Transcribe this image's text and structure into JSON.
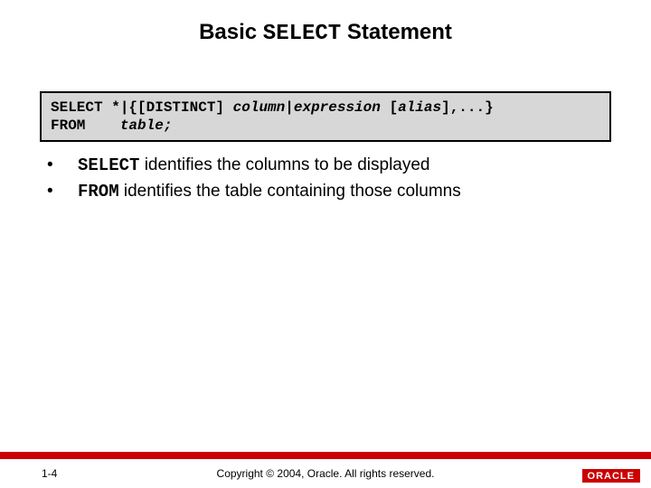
{
  "title": {
    "pre": "Basic ",
    "mono": "SELECT",
    "post": " Statement"
  },
  "syntax": {
    "line1": {
      "p1": "SELECT *|{[DISTINCT] ",
      "i1": "column",
      "p2": "|",
      "i2": "expression",
      "p3": " [",
      "i3": "alias",
      "p4": "],...}"
    },
    "line2": {
      "p1": "FROM    ",
      "i1": "table;"
    }
  },
  "bullets": [
    {
      "mono": "SELECT",
      "rest": " identifies the columns to be displayed"
    },
    {
      "mono": "FROM",
      "rest": " identifies the table containing those columns"
    }
  ],
  "footer": {
    "page": "1-4",
    "copyright": "Copyright © 2004, Oracle.  All rights reserved.",
    "logo": "ORACLE"
  }
}
